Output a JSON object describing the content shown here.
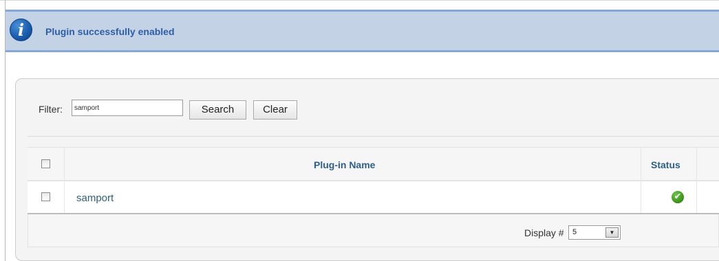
{
  "message": {
    "text": "Plugin successfully enabled",
    "icon": "info-icon",
    "icon_glyph": "i"
  },
  "filter": {
    "label": "Filter:",
    "value": "samport",
    "search_label": "Search",
    "clear_label": "Clear"
  },
  "table": {
    "columns": [
      "Plug-in Name",
      "Status"
    ],
    "rows": [
      {
        "name": "samport",
        "status": "enabled",
        "status_icon": "check-circle-icon",
        "status_glyph": "✔"
      }
    ]
  },
  "pagination": {
    "display_label": "Display #",
    "display_value": "5",
    "arrow_glyph": "▼"
  },
  "colors": {
    "message_bg": "#c3d2e5",
    "message_border": "#84a7db",
    "link": "#2c5f8a",
    "status_ok": "#3e9a1c"
  }
}
